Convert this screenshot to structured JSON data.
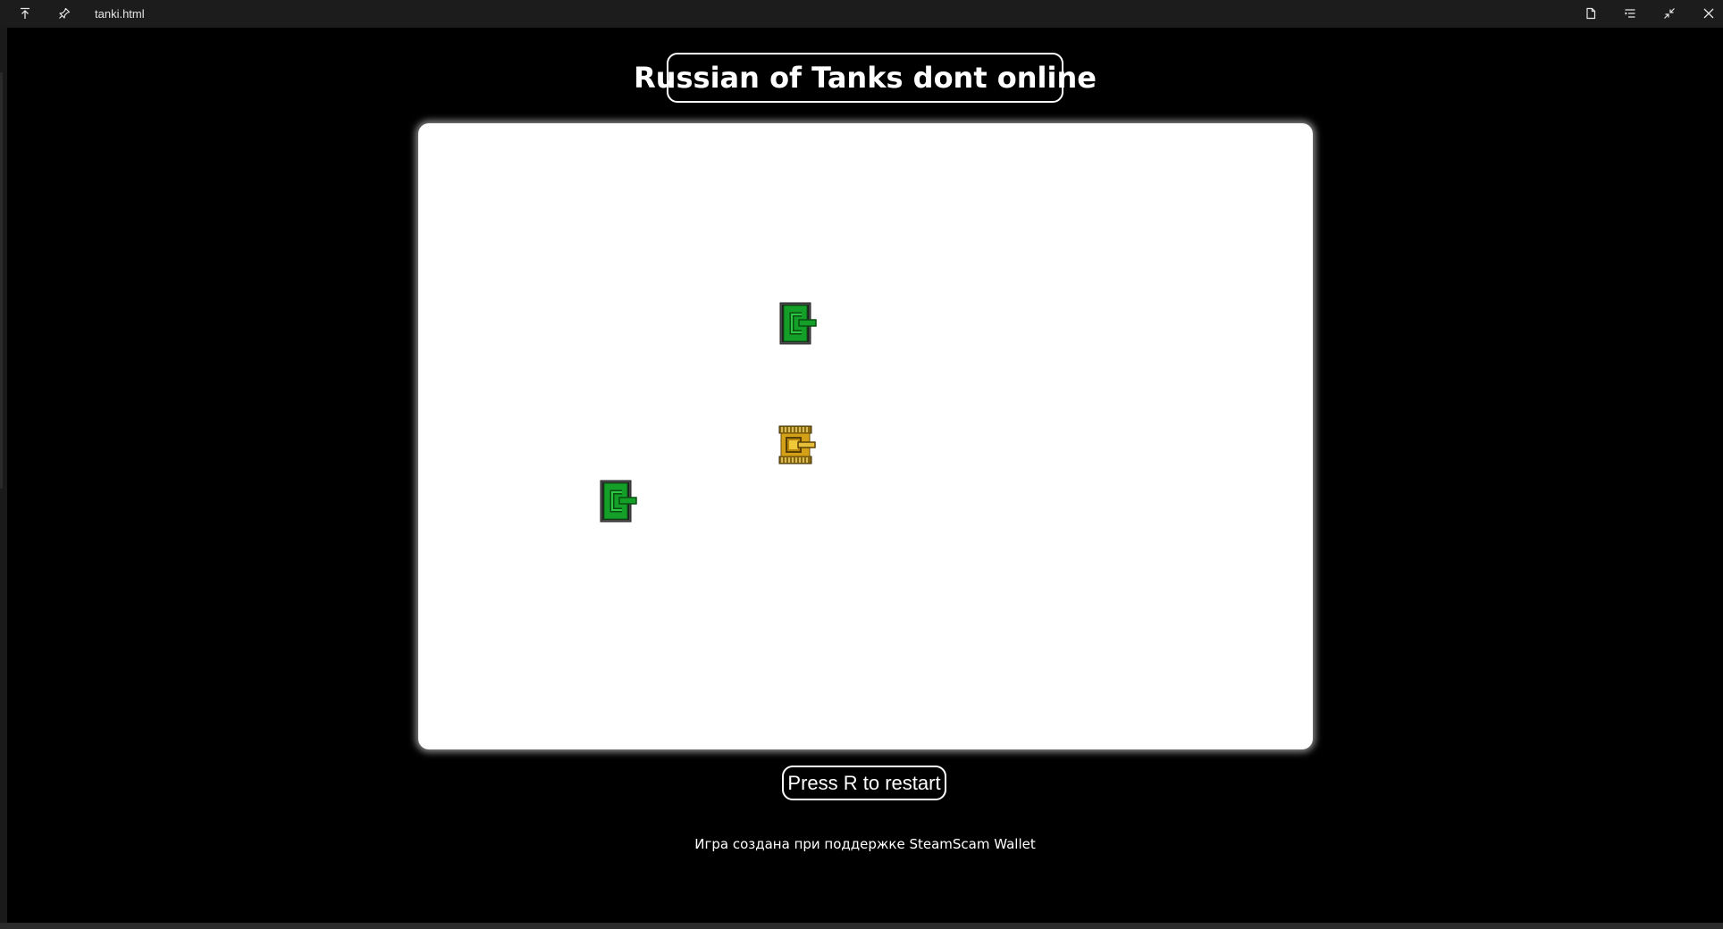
{
  "window": {
    "filename": "tanki.html",
    "icons": [
      "arrow-up-to-line-icon",
      "pin-icon",
      "page-icon",
      "list-settings-icon",
      "collapse-icon",
      "close-icon"
    ]
  },
  "game": {
    "title": "Russian of Tanks dont online",
    "restart_hint": "Press R to restart",
    "credits": "Игра создана при поддержке SteamScam Wallet"
  },
  "tanks": [
    {
      "type": "enemy",
      "color": "#14a028",
      "facing": "right"
    },
    {
      "type": "player",
      "color": "#d4a017",
      "facing": "right"
    },
    {
      "type": "enemy",
      "color": "#14a028",
      "facing": "right"
    }
  ],
  "colors": {
    "background": "#000000",
    "canvas": "#ffffff",
    "enemy_tank": "#14a028",
    "player_tank": "#d4a017"
  }
}
